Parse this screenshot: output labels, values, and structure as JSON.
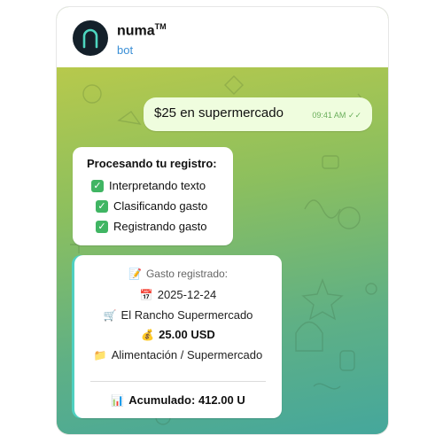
{
  "header": {
    "name": "numa",
    "trademark": "TM",
    "subtitle": "bot",
    "avatar_letter": "n"
  },
  "outgoing": {
    "text": "$25 en supermercado",
    "time": "09:41 AM",
    "status": "✓✓"
  },
  "processing": {
    "title": "Procesando tu registro:",
    "steps": [
      {
        "label": "Interpretando texto"
      },
      {
        "label": "Clasificando gasto"
      },
      {
        "label": "Registrando gasto"
      }
    ]
  },
  "expense": {
    "heading": "Gasto registrado:",
    "date": "2025-12-24",
    "merchant": "El Rancho Supermercado",
    "amount": "25.00 USD",
    "category": "Alimentación / Supermercado",
    "accumulated": "Acumulado: 412.00 U"
  },
  "colors": {
    "accent_blue": "#3a8fd6",
    "check_green": "#40b563",
    "outgoing_bubble": "#effdde",
    "bg_top": "#b7c94c",
    "bg_bottom": "#45a79c"
  }
}
